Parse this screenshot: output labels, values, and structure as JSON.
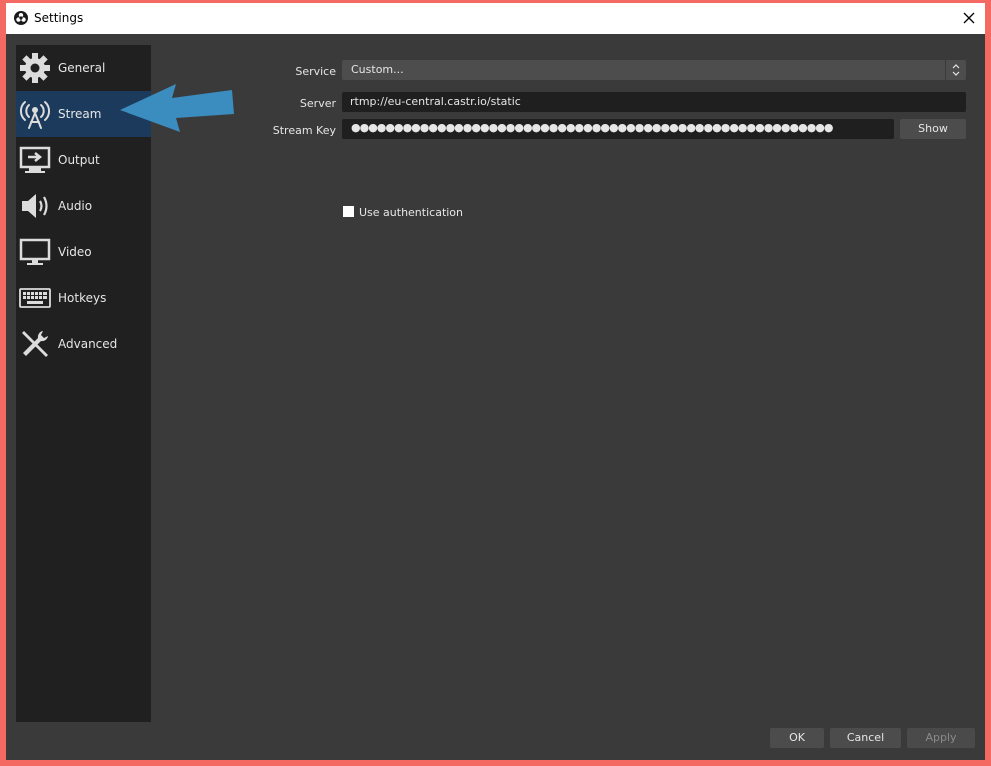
{
  "window": {
    "title": "Settings"
  },
  "sidebar": {
    "items": [
      {
        "label": "General",
        "icon": "gear-icon"
      },
      {
        "label": "Stream",
        "icon": "broadcast-antenna-icon",
        "selected": true
      },
      {
        "label": "Output",
        "icon": "output-monitor-icon"
      },
      {
        "label": "Audio",
        "icon": "speaker-icon"
      },
      {
        "label": "Video",
        "icon": "monitor-icon"
      },
      {
        "label": "Hotkeys",
        "icon": "keyboard-icon"
      },
      {
        "label": "Advanced",
        "icon": "tools-icon"
      }
    ]
  },
  "stream": {
    "service_label": "Service",
    "service_value": "Custom...",
    "server_label": "Server",
    "server_value": "rtmp://eu-central.castr.io/static",
    "stream_key_label": "Stream Key",
    "stream_key_masked": "●●●●●●●●●●●●●●●●●●●●●●●●●●●●●●●●●●●●●●●●●●●●●●●●●●●●●●●●",
    "show_label": "Show",
    "use_auth_label": "Use authentication",
    "use_auth_checked": false
  },
  "footer": {
    "ok_label": "OK",
    "cancel_label": "Cancel",
    "apply_label": "Apply"
  },
  "colors": {
    "accent_arrow": "#3b8cbf",
    "selected_nav": "#1c3b5c",
    "frame_border": "#f46a62"
  }
}
